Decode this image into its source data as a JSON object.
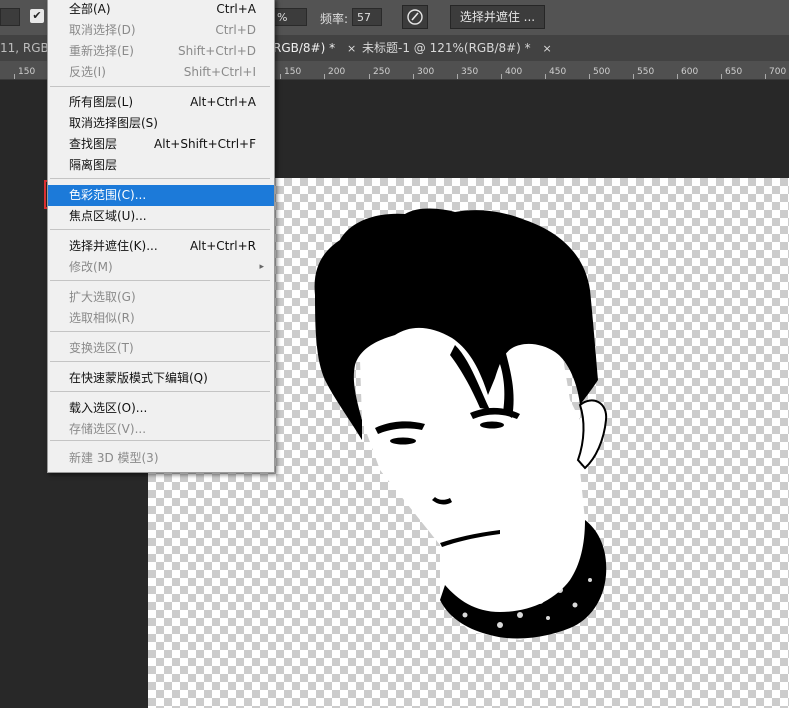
{
  "options_bar": {
    "pct_value": "%",
    "freq_label": "频率:",
    "freq_value": "57",
    "select_mask_button": "选择并遮住 ..."
  },
  "tabs": [
    {
      "label": "11, RGB/"
    },
    {
      "label": "RGB/8#) *",
      "close": "×"
    },
    {
      "label": "未标题-1 @ 121%(RGB/8#) *",
      "close": "×"
    }
  ],
  "ruler": [
    "150",
    "150",
    "200",
    "250",
    "300",
    "350",
    "400",
    "450",
    "500",
    "550",
    "600",
    "650",
    "700"
  ],
  "menu": {
    "items": [
      {
        "label": "全部(A)",
        "shortcut": "Ctrl+A",
        "disabled": false
      },
      {
        "label": "取消选择(D)",
        "shortcut": "Ctrl+D",
        "disabled": true
      },
      {
        "label": "重新选择(E)",
        "shortcut": "Shift+Ctrl+D",
        "disabled": true
      },
      {
        "label": "反选(I)",
        "shortcut": "Shift+Ctrl+I",
        "disabled": true
      },
      {
        "label": "所有图层(L)",
        "shortcut": "Alt+Ctrl+A",
        "disabled": false
      },
      {
        "label": "取消选择图层(S)",
        "shortcut": "",
        "disabled": false
      },
      {
        "label": "查找图层",
        "shortcut": "Alt+Shift+Ctrl+F",
        "disabled": false
      },
      {
        "label": "隔离图层",
        "shortcut": "",
        "disabled": false
      },
      {
        "label": "色彩范围(C)...",
        "shortcut": "",
        "disabled": false,
        "highlighted": true
      },
      {
        "label": "焦点区域(U)...",
        "shortcut": "",
        "disabled": false
      },
      {
        "label": "选择并遮住(K)...",
        "shortcut": "Alt+Ctrl+R",
        "disabled": false
      },
      {
        "label": "修改(M)",
        "shortcut": "",
        "disabled": true,
        "submenu": "▸"
      },
      {
        "label": "扩大选取(G)",
        "shortcut": "",
        "disabled": true
      },
      {
        "label": "选取相似(R)",
        "shortcut": "",
        "disabled": true
      },
      {
        "label": "变换选区(T)",
        "shortcut": "",
        "disabled": true
      },
      {
        "label": "在快速蒙版模式下编辑(Q)",
        "shortcut": "",
        "disabled": false
      },
      {
        "label": "载入选区(O)...",
        "shortcut": "",
        "disabled": false
      },
      {
        "label": "存储选区(V)...",
        "shortcut": "",
        "disabled": true
      },
      {
        "label": "新建 3D 模型(3)",
        "shortcut": "",
        "disabled": true
      }
    ]
  },
  "colors": {
    "highlight": "#1c7ad9",
    "annotation_box": "#e03030"
  }
}
